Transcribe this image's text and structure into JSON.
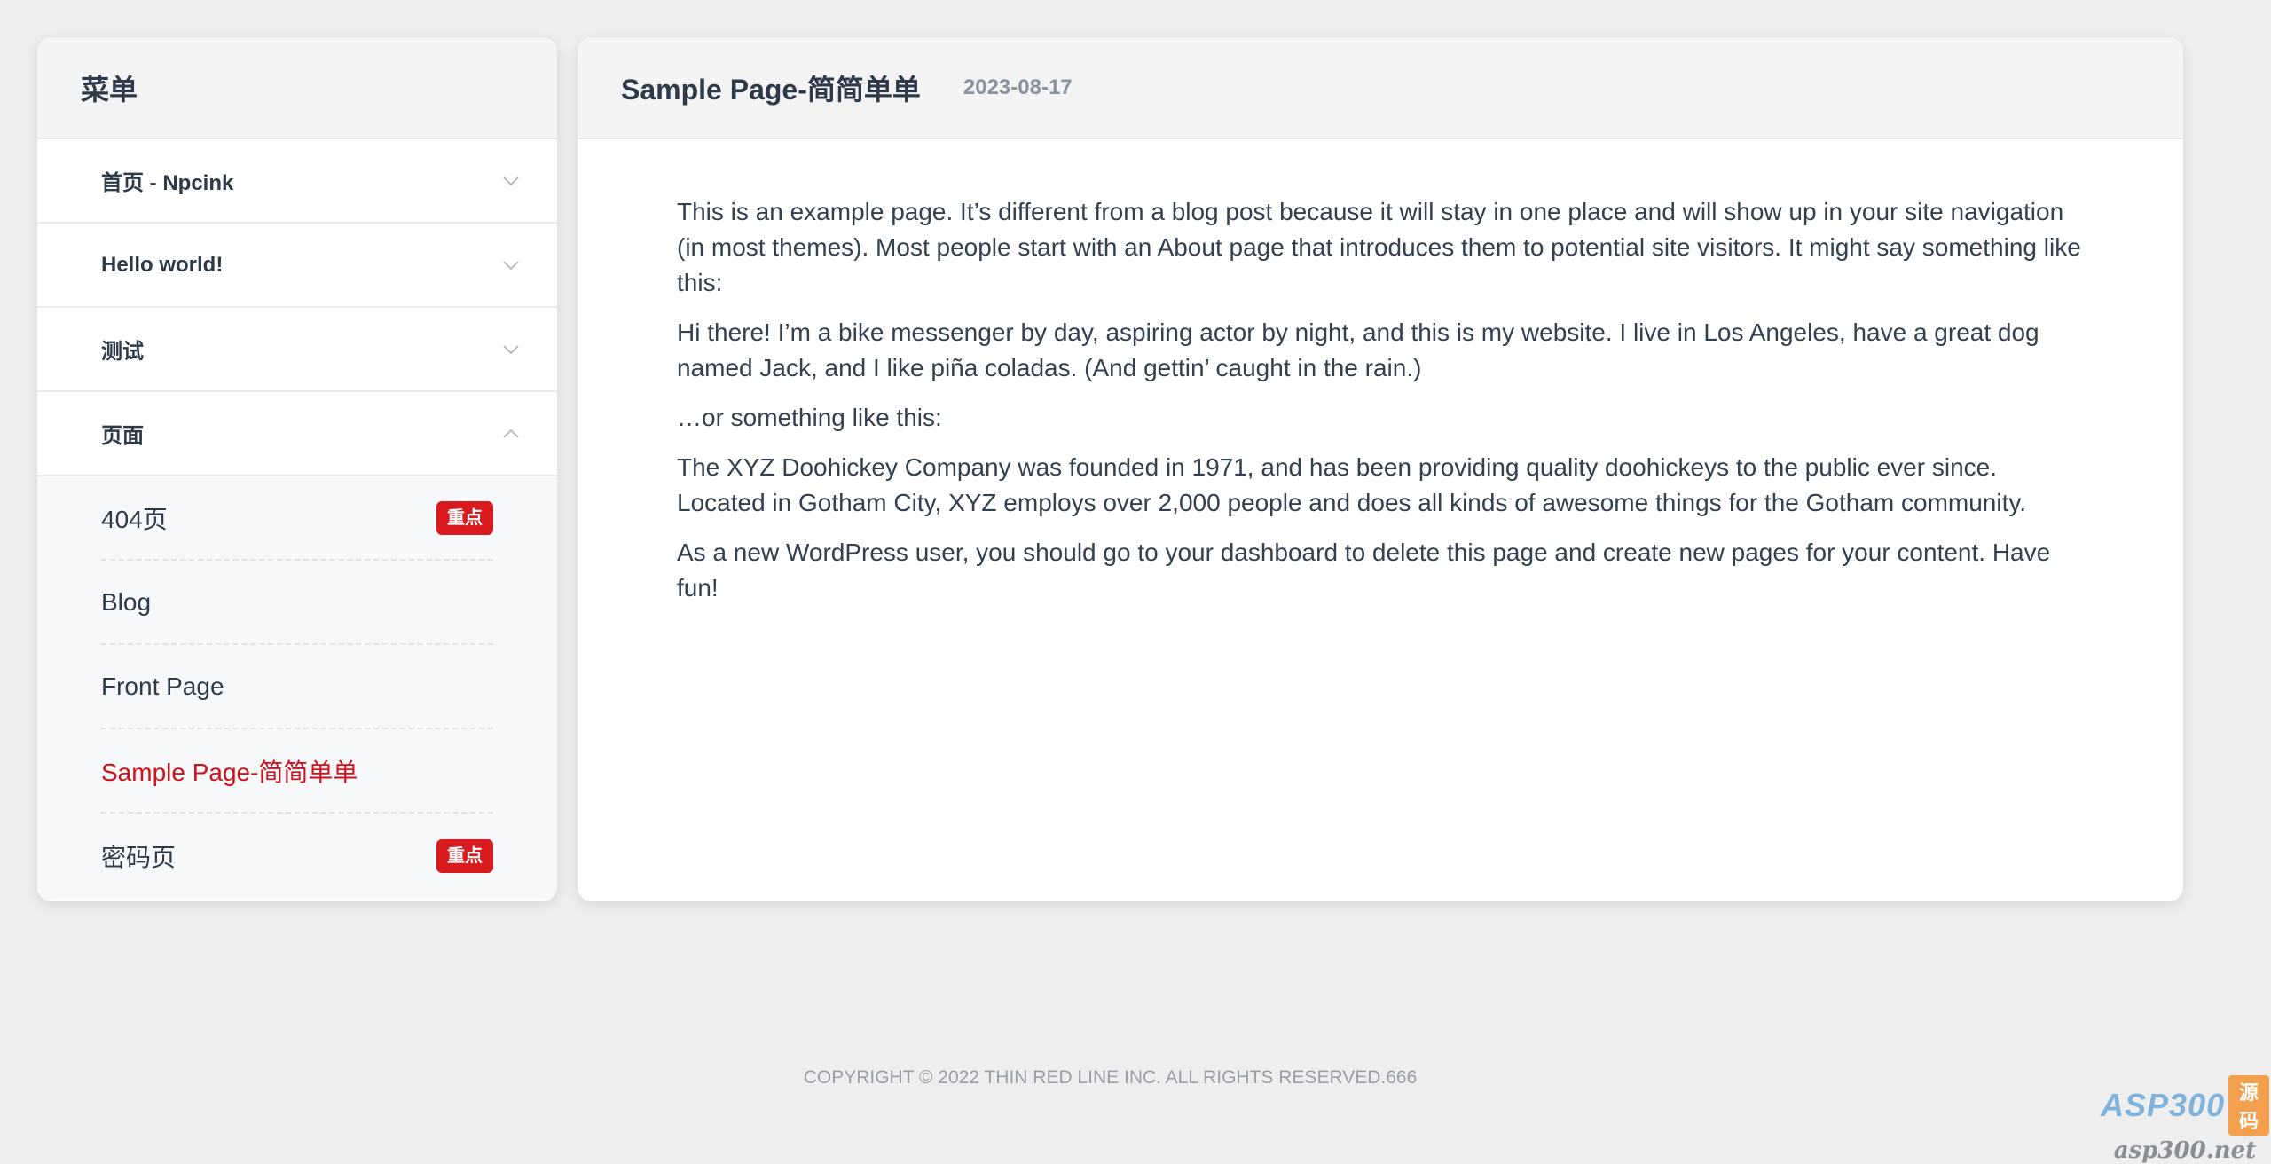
{
  "sidebar": {
    "title": "菜单",
    "menu": [
      {
        "label": "首页 - Npcink",
        "expanded": false
      },
      {
        "label": "Hello world!",
        "expanded": false
      },
      {
        "label": "测试",
        "expanded": false
      },
      {
        "label": "页面",
        "expanded": true
      }
    ],
    "submenu": [
      {
        "label": "404页",
        "badge": "重点",
        "active": false
      },
      {
        "label": "Blog",
        "badge": "",
        "active": false
      },
      {
        "label": "Front Page",
        "badge": "",
        "active": false
      },
      {
        "label": "Sample Page-简简单单",
        "badge": "",
        "active": true
      },
      {
        "label": "密码页",
        "badge": "重点",
        "active": false
      }
    ]
  },
  "main": {
    "title": "Sample Page-简简单单",
    "date": "2023-08-17",
    "paragraphs": [
      "This is an example page. It’s different from a blog post because it will stay in one place and will show up in your site navigation (in most themes). Most people start with an About page that introduces them to potential site visitors. It might say something like this:",
      "Hi there! I’m a bike messenger by day, aspiring actor by night, and this is my website. I live in Los Angeles, have a great dog named Jack, and I like piña coladas. (And gettin’ caught in the rain.)",
      "…or something like this:",
      "The XYZ Doohickey Company was founded in 1971, and has been providing quality doohickeys to the public ever since. Located in Gotham City, XYZ employs over 2,000 people and does all kinds of awesome things for the Gotham community.",
      "As a new WordPress user, you should go to your dashboard to delete this page and create new pages for your content. Have fun!"
    ]
  },
  "footer": {
    "copyright": "COPYRIGHT © 2022 THIN RED LINE INC. ALL RIGHTS RESERVED.666"
  },
  "watermark": {
    "main": "ASP300",
    "tag": "源码",
    "sub": "asp300.net"
  },
  "colors": {
    "background": "#eeeeef",
    "card": "#ffffff",
    "header_bg": "#f4f4f5",
    "accent_red": "#d0111b",
    "badge_red": "#d91a1f",
    "text": "#33404f",
    "muted": "#8a93a0"
  },
  "icons": {
    "collapsed": "chevron-down-icon",
    "expanded": "chevron-up-icon"
  }
}
